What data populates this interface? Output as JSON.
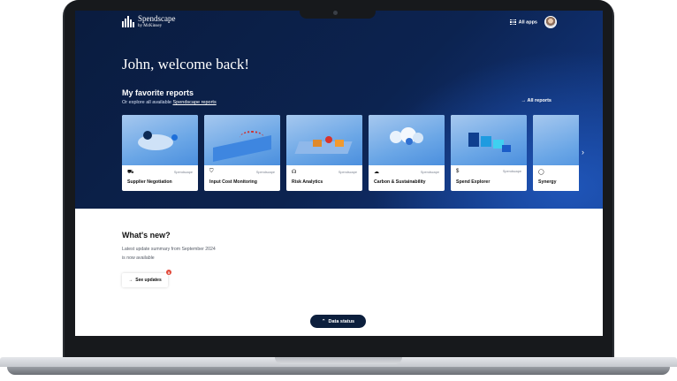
{
  "brand": {
    "name": "Spendscape",
    "sub": "by McKinsey"
  },
  "header": {
    "all_apps": "All apps"
  },
  "hero": {
    "welcome": "John, welcome back!",
    "fav_title": "My favorite reports",
    "fav_sub_prefix": "Or explore all available ",
    "fav_sub_link": "Spendscape reports",
    "all_reports": "All reports"
  },
  "cards": [
    {
      "title": "Supplier Negotiation",
      "source": "Spendscape",
      "icon": "handshake-icon"
    },
    {
      "title": "Input Cost Monitoring",
      "source": "Spendscape",
      "icon": "shield-icon"
    },
    {
      "title": "Risk Analytics",
      "source": "Spendscape",
      "icon": "risk-icon"
    },
    {
      "title": "Carbon & Sustainability",
      "source": "Spendscape",
      "icon": "cloud-icon"
    },
    {
      "title": "Spend Explorer",
      "source": "Spendscape",
      "icon": "dollar-icon"
    },
    {
      "title": "Synergy",
      "source": "",
      "icon": "synergy-icon"
    }
  ],
  "whats_new": {
    "title": "What's new?",
    "text": "Latest update summary from September 2024 is now available",
    "button": "See updates",
    "badge": "5"
  },
  "data_status": {
    "label": "Data status"
  },
  "colors": {
    "hero_dark": "#0a1c3f",
    "hero_blue": "#1f55b8",
    "badge": "#e24a3b"
  }
}
